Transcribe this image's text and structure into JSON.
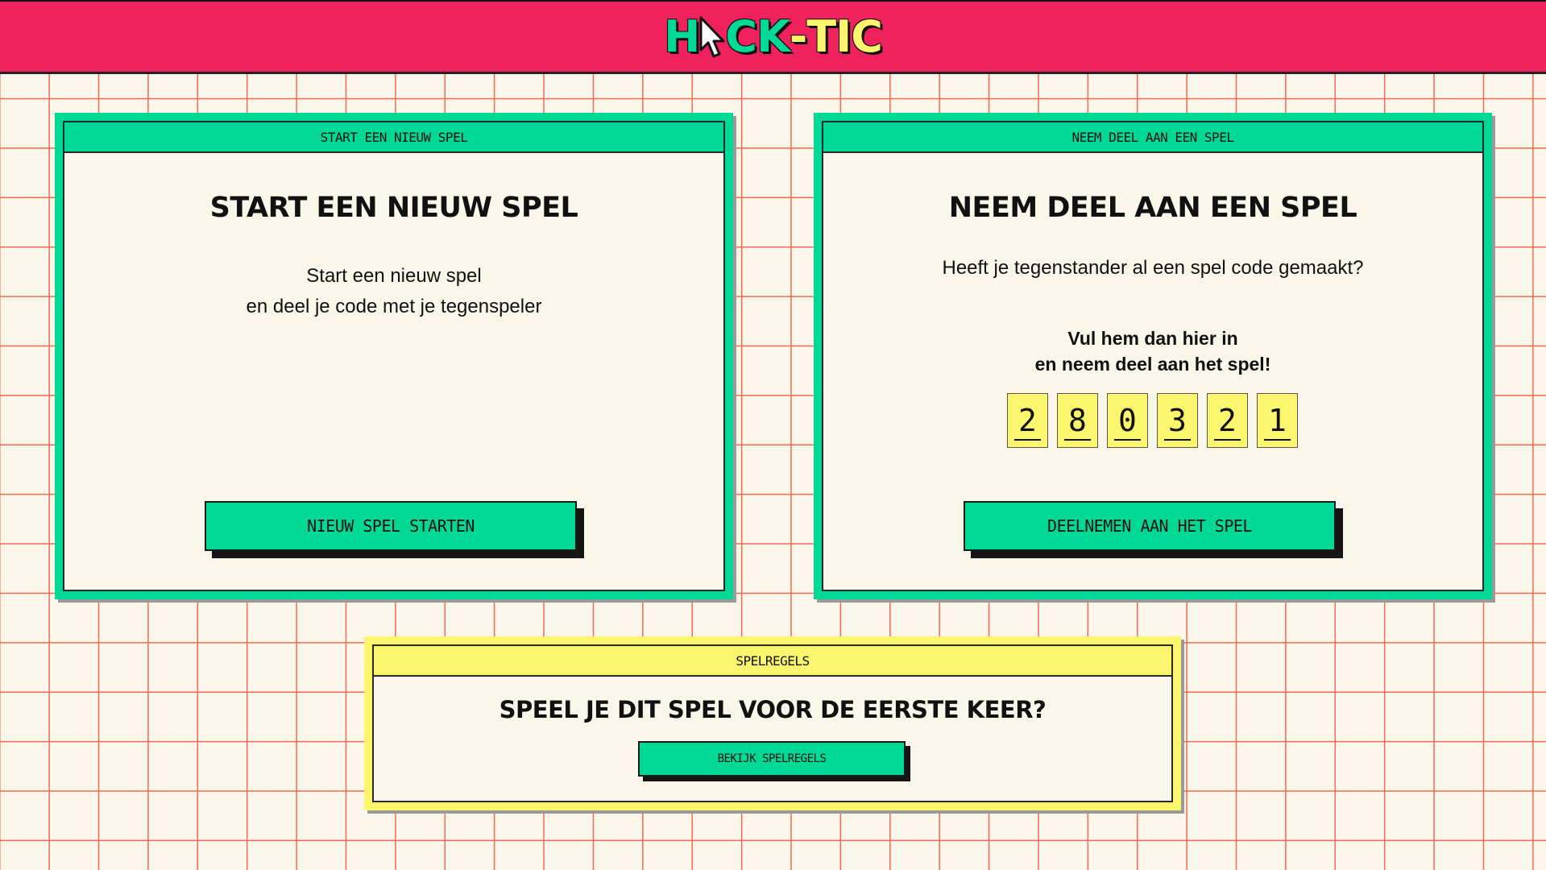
{
  "header": {
    "logo": {
      "h": "H",
      "rest_green": "CK",
      "dash": "-",
      "rest_yellow": "TIC",
      "cursor": "cursor-arrow-icon"
    },
    "background_color": "#ef225e"
  },
  "new_game": {
    "tab_label": "START EEN NIEUW SPEL",
    "title": "START EEN NIEUW SPEL",
    "line1": "Start een nieuw spel",
    "line2": "en deel je code met je tegenspeler",
    "button_label": "NIEUW SPEL STARTEN"
  },
  "join_game": {
    "tab_label": "NEEM DEEL AAN EEN SPEL",
    "title": "NEEM DEEL AAN EEN SPEL",
    "question": "Heeft je tegenstander al een spel code gemaakt?",
    "bold_line1": "Vul hem dan hier in",
    "bold_line2": "en neem deel aan het spel!",
    "code_digits": [
      "2",
      "8",
      "0",
      "3",
      "2",
      "1"
    ],
    "button_label": "DEELNEMEN AAN HET SPEL"
  },
  "rules": {
    "tab_label": "SPELREGELS",
    "title": "SPEEL JE DIT SPEL VOOR DE EERSTE KEER?",
    "button_label": "BEKIJK SPELREGELS"
  },
  "colors": {
    "green": "#00d996",
    "yellow": "#fbf66e",
    "pink": "#ef225e",
    "grid_line": "#ef6a52",
    "background": "#faf6ea"
  }
}
